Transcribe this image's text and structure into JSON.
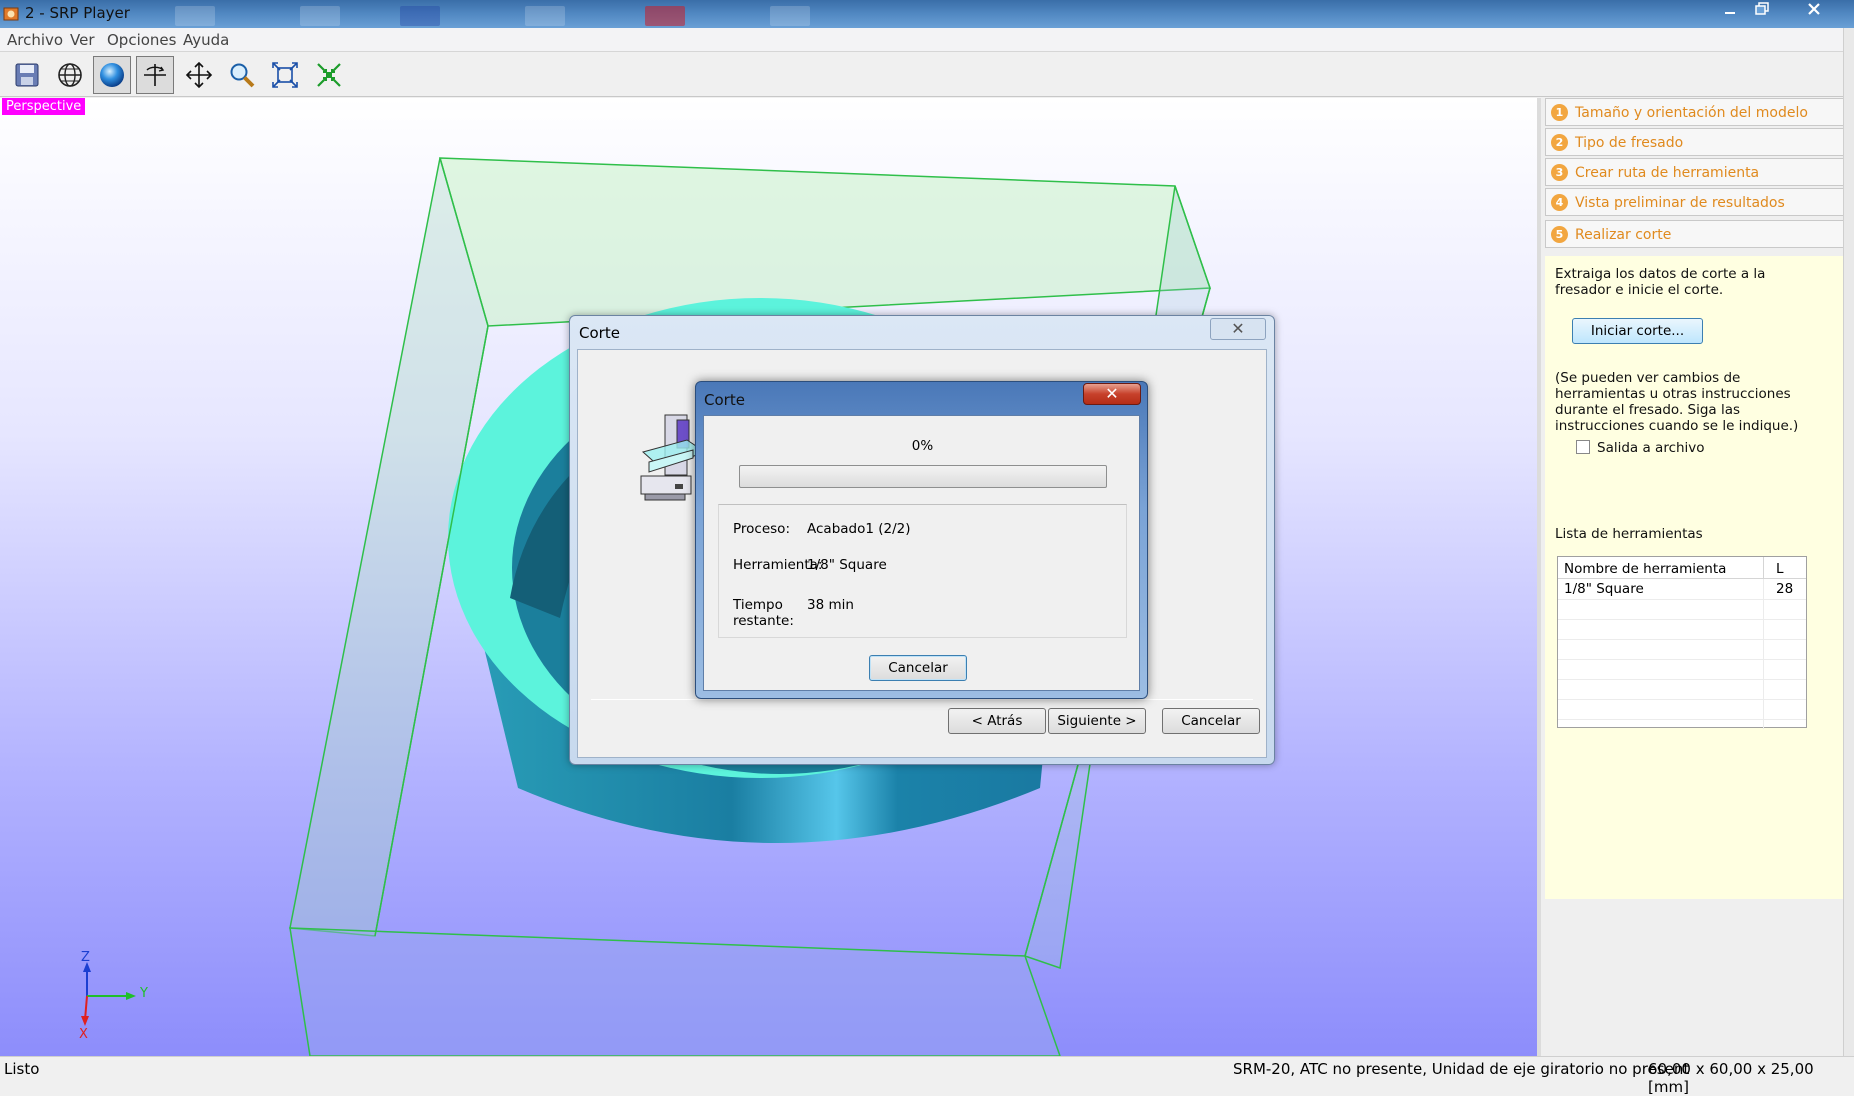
{
  "window": {
    "title": "2 - SRP Player"
  },
  "menu": [
    "Archivo",
    "Ver",
    "Opciones",
    "Ayuda"
  ],
  "toolbar": {
    "icons": [
      "save-icon",
      "wireframe-globe-icon",
      "shaded-sphere-icon",
      "rotate-icon",
      "pan-icon",
      "zoom-icon",
      "fit-view-icon",
      "zoom-extents-icon"
    ],
    "active": [
      "shaded-sphere-icon",
      "rotate-icon"
    ]
  },
  "viewport": {
    "label": "Perspective",
    "axes": {
      "z": "Z",
      "y": "Y",
      "x": "X"
    }
  },
  "steps": [
    {
      "num": "1",
      "label": "Tamaño y orientación del modelo"
    },
    {
      "num": "2",
      "label": "Tipo de fresado"
    },
    {
      "num": "3",
      "label": "Crear ruta de herramienta"
    },
    {
      "num": "4",
      "label": "Vista preliminar de resultados"
    },
    {
      "num": "5",
      "label": "Realizar corte"
    }
  ],
  "panel": {
    "intro": "Extraiga los datos de corte a la fresador e inicie el corte.",
    "start_button": "Iniciar corte...",
    "note": "(Se pueden ver cambios de herramientas u otras instrucciones durante el fresado. Siga las instrucciones cuando se le indique.)",
    "file_output_label": "Salida a archivo",
    "file_output_checked": false,
    "tools_title": "Lista de herramientas",
    "table": {
      "columns": [
        "Nombre de herramienta",
        "L"
      ],
      "rows": [
        {
          "name": "1/8\" Square",
          "l": "28"
        }
      ]
    }
  },
  "dialog_outer": {
    "title": "Corte",
    "close_glyph": "✕",
    "buttons": {
      "back": "< Atrás",
      "next": "Siguiente >",
      "cancel": "Cancelar"
    }
  },
  "dialog_inner": {
    "title": "Corte",
    "close_glyph": "✕",
    "progress_text": "0%",
    "progress_value": 0,
    "process_label": "Proceso:",
    "process_value": "Acabado1 (2/2)",
    "tool_label": "Herramienta:",
    "tool_value": "1/8\" Square",
    "time_label_1": "Tiempo",
    "time_label_2": "restante:",
    "time_value": "38 min",
    "cancel": "Cancelar"
  },
  "status": {
    "left": "Listo",
    "machine": "SRM-20, ATC no presente, Unidad de eje giratorio no present",
    "dims": "60,00 x  60,00 x  25,00 [mm]"
  },
  "colors": {
    "accent": "#f2a640",
    "step_text": "#e08a1e",
    "panel_bg": "#ffffe1",
    "model": "#1f89a8",
    "model_top": "#54f5dc"
  }
}
